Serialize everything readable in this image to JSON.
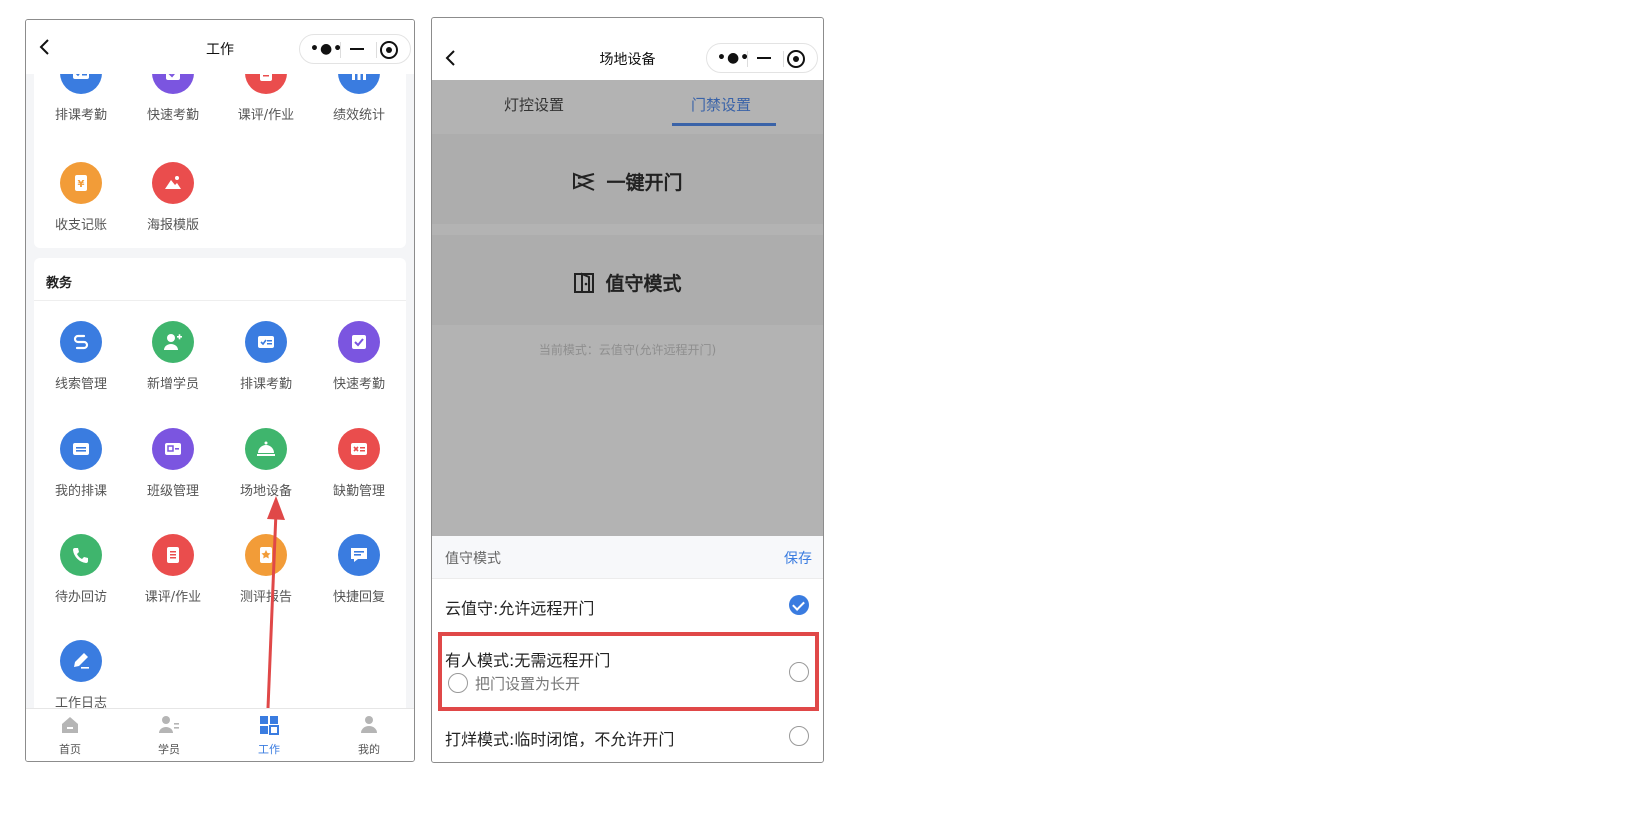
{
  "left_screen": {
    "nav": {
      "title": "工作"
    },
    "top_row": {
      "items": [
        {
          "label": "排课考勤",
          "icon": "schedule-icon",
          "color": "#3a7ce0"
        },
        {
          "label": "快速考勤",
          "icon": "check-card-icon",
          "color": "#7b55e0"
        },
        {
          "label": "课评/作业",
          "icon": "list-icon",
          "color": "#ea4d4d"
        },
        {
          "label": "绩效统计",
          "icon": "bar-chart-icon",
          "color": "#3a7ce0"
        }
      ]
    },
    "finance_row": {
      "items": [
        {
          "label": "收支记账",
          "icon": "yuan-icon",
          "color": "#f29c38"
        },
        {
          "label": "海报模版",
          "icon": "picture-icon",
          "color": "#ea4d4d"
        }
      ]
    },
    "jiaowu": {
      "title": "教务",
      "items": [
        {
          "label": "线索管理",
          "icon": "link-icon",
          "color": "#3a7ce0"
        },
        {
          "label": "新增学员",
          "icon": "add-user-icon",
          "color": "#3fb56d"
        },
        {
          "label": "排课考勤",
          "icon": "schedule-icon",
          "color": "#3a7ce0"
        },
        {
          "label": "快速考勤",
          "icon": "check-card-icon",
          "color": "#7b55e0"
        },
        {
          "label": "我的排课",
          "icon": "calendar-icon",
          "color": "#3a7ce0"
        },
        {
          "label": "班级管理",
          "icon": "class-icon",
          "color": "#7b55e0"
        },
        {
          "label": "场地设备",
          "icon": "bell-cover-icon",
          "color": "#3fb56d"
        },
        {
          "label": "缺勤管理",
          "icon": "absence-icon",
          "color": "#ea4d4d"
        },
        {
          "label": "待办回访",
          "icon": "phone-icon",
          "color": "#3fb56d"
        },
        {
          "label": "课评/作业",
          "icon": "list-icon",
          "color": "#ea4d4d"
        },
        {
          "label": "测评报告",
          "icon": "star-report-icon",
          "color": "#f29c38"
        },
        {
          "label": "快捷回复",
          "icon": "message-icon",
          "color": "#3a7ce0"
        },
        {
          "label": "工作日志",
          "icon": "pen-icon",
          "color": "#3a7ce0"
        }
      ]
    },
    "tabbar": [
      {
        "label": "首页",
        "icon": "home-icon",
        "active": false
      },
      {
        "label": "学员",
        "icon": "students-icon",
        "active": false
      },
      {
        "label": "工作",
        "icon": "grid-icon",
        "active": true
      },
      {
        "label": "我的",
        "icon": "profile-icon",
        "active": false
      }
    ]
  },
  "right_screen": {
    "nav": {
      "title": "场地设备"
    },
    "tabs": [
      {
        "label": "灯控设置",
        "active": false
      },
      {
        "label": "门禁设置",
        "active": true
      }
    ],
    "one_key_open": "一键开门",
    "duty_mode": "值守模式",
    "current_mode": "当前模式：云值守(允许远程开门)",
    "sheet": {
      "title": "值守模式",
      "save": "保存",
      "options": [
        {
          "label": "云值守:允许远程开门",
          "checked": true
        },
        {
          "label": "有人模式:无需远程开门",
          "checked": false,
          "sub_label": "把门设置为长开"
        },
        {
          "label": "打烊模式:临时闭馆，不允许开门",
          "checked": false
        }
      ]
    }
  },
  "colors": {
    "accent": "#3a7ce0",
    "annotation": "#e04848"
  }
}
